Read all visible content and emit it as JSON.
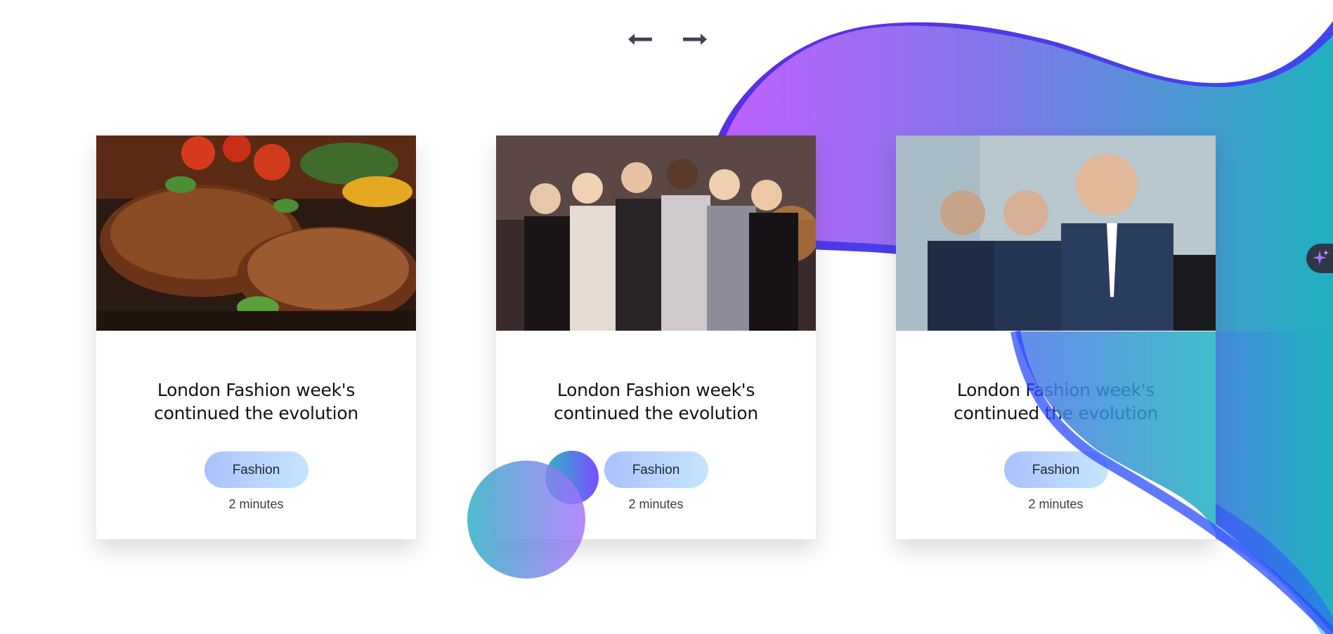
{
  "colors": {
    "blob_start": "#c061ff",
    "blob_end": "#1fb1bf",
    "arrow": "#3d4350",
    "tag_start": "#a8c3ff",
    "tag_end": "#c5e6ff"
  },
  "nav": {
    "prev_icon": "arrow-left-icon",
    "next_icon": "arrow-right-icon"
  },
  "cards": [
    {
      "image": "grilled-steak-photo",
      "title": "London Fashion week's continued the evolution",
      "tag": "Fashion",
      "duration": "2 minutes"
    },
    {
      "image": "party-crowd-photo",
      "title": "London Fashion week's continued the evolution",
      "tag": "Fashion",
      "duration": "2 minutes"
    },
    {
      "image": "business-people-photo",
      "title": "London Fashion week's continued the evolution",
      "tag": "Fashion",
      "duration": "2 minutes"
    }
  ],
  "assistant": {
    "icon": "sparkle-icon"
  }
}
